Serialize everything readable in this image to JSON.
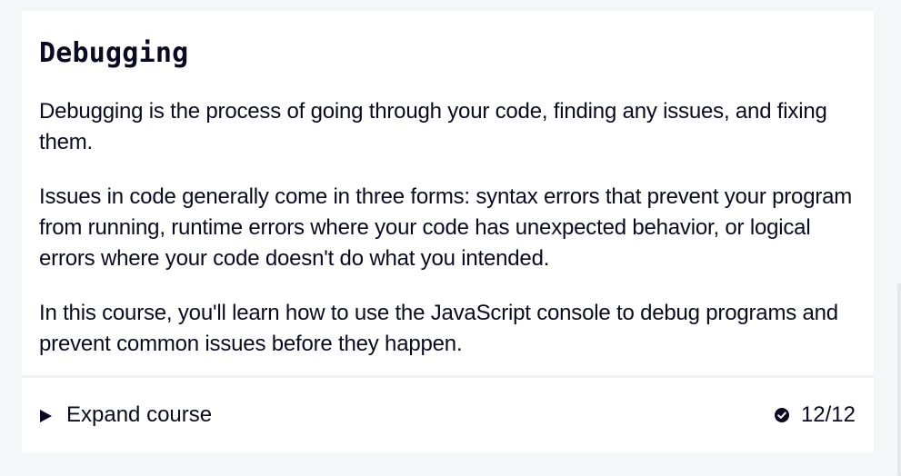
{
  "card": {
    "title": "Debugging",
    "paragraphs": [
      "Debugging is the process of going through your code, finding any issues, and fixing them.",
      "Issues in code generally come in three forms: syntax errors that prevent your program from running, runtime errors where your code has unexpected behavior, or logical errors where your code doesn't do what you intended.",
      "In this course, you'll learn how to use the JavaScript console to debug programs and prevent common issues before they happen."
    ]
  },
  "footer": {
    "expand_label": "Expand course",
    "progress_label": "12/12"
  },
  "icons": {
    "expand": "triangle-right-icon",
    "progress": "check-circle-icon"
  },
  "colors": {
    "background": "#f5f6f7",
    "card": "#ffffff",
    "text": "#0a0a23"
  }
}
